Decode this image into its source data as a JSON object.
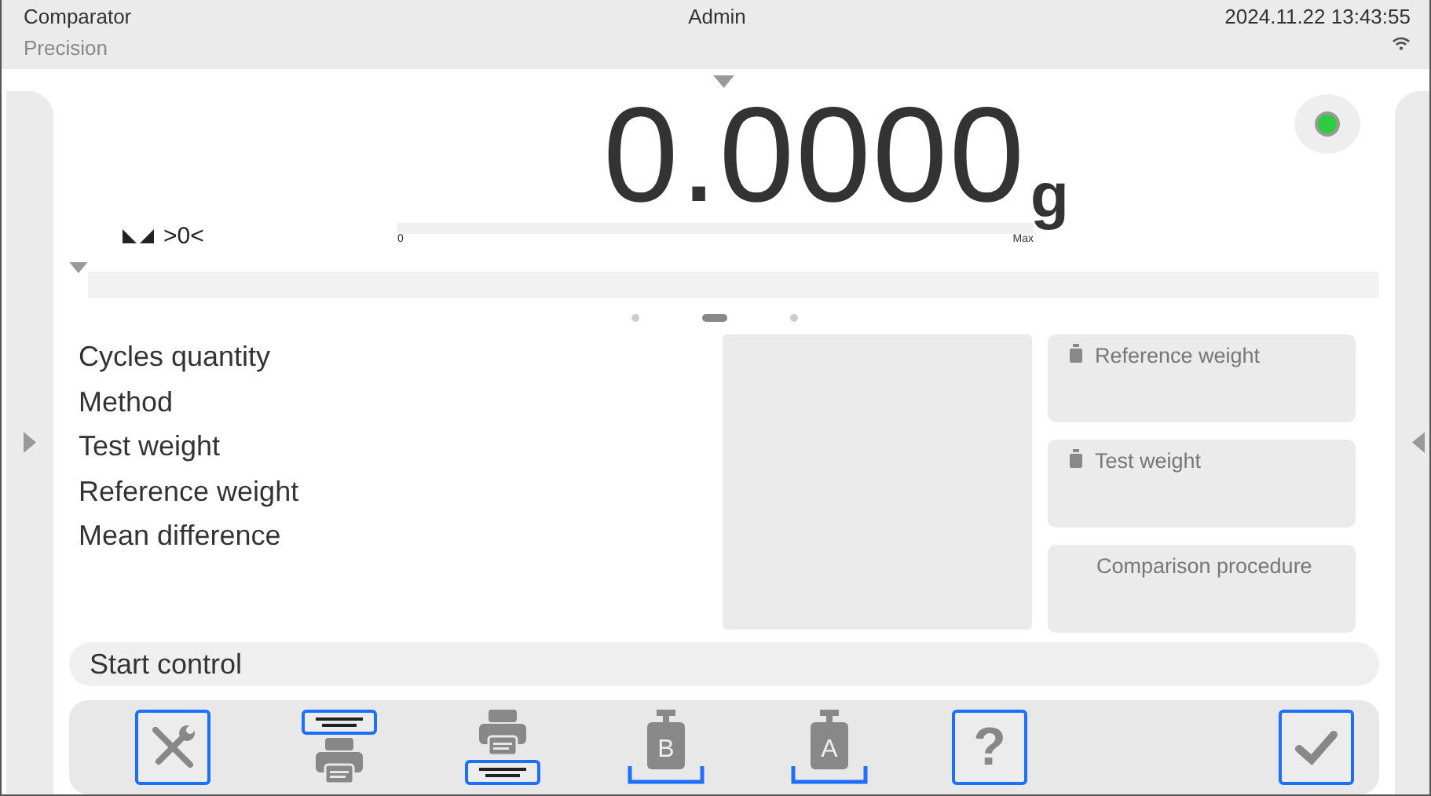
{
  "header": {
    "mode": "Comparator",
    "profile": "Precision",
    "user": "Admin",
    "datetime": "2024.11.22 13:43:55"
  },
  "display": {
    "value": "0.0000",
    "unit": "g",
    "status": {
      "color": "#2ecc40"
    },
    "zero_indicator": ">0<",
    "bargraph": {
      "min_label": "0",
      "max_label": "Max",
      "level": 0
    }
  },
  "pager": [
    {
      "selected": false
    },
    {
      "selected": true
    },
    {
      "selected": false
    }
  ],
  "info_fields": [
    "Cycles quantity",
    "Method",
    "Test weight",
    "Reference weight",
    "Mean difference"
  ],
  "tiles": [
    {
      "kind": "weight",
      "label": "Reference weight"
    },
    {
      "kind": "weight",
      "label": "Test weight"
    },
    {
      "kind": "plain",
      "label": "Comparison procedure"
    }
  ],
  "start_control": "Start control",
  "toolbar": [
    {
      "kind": "setup"
    },
    {
      "kind": "print_header"
    },
    {
      "kind": "print_footer"
    },
    {
      "kind": "weight",
      "letter": "B"
    },
    {
      "kind": "weight",
      "letter": "A"
    },
    {
      "kind": "help",
      "glyph": "?"
    },
    {
      "kind": "spacer"
    },
    {
      "kind": "confirm"
    }
  ]
}
